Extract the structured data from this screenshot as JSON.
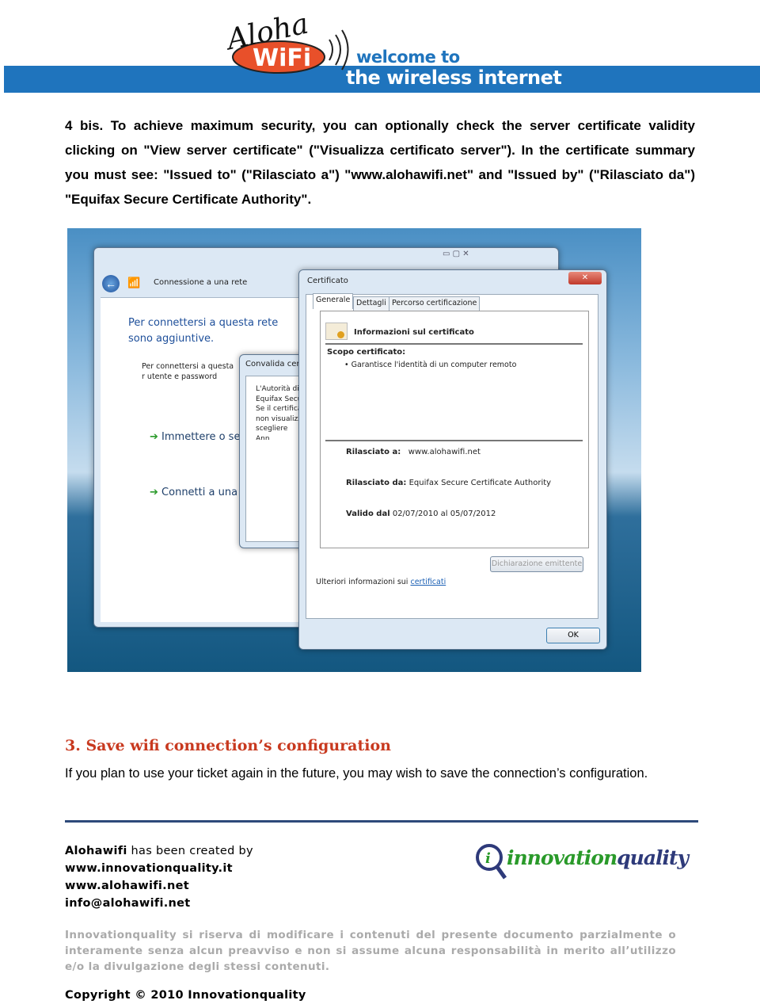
{
  "header": {
    "logo_text": "Aloha WiFi",
    "welcome": "welcome to",
    "tagline": "the wireless internet",
    "brand_blue": "#1f74bd",
    "brand_orange": "#e8502a"
  },
  "intro": "4 bis. To achieve maximum security, you can optionally check the server certificate validity clicking on \"View server certificate\" (\"Visualizza certificato server\"). In the certificate summary you must see: \"Issued to\" (\"Rilasciato a\") \"www.alohawifi.net\" and \"Issued by\" (\"Rilasciato da\") \"Equifax Secure Certificate Authority\".",
  "screenshot": {
    "network_window": {
      "title": "Connessione a una rete",
      "heading": "Per connettersi a questa rete sono aggiuntive.",
      "desc": "Per connettersi a questa r utente e password",
      "option1": "Immettere o se",
      "option2": "Connetti a una"
    },
    "validate_dialog": {
      "title": "Convalida cer",
      "body": "L'Autorità di Equifax Secu Se il certifica non visualizz scegliere Ann"
    },
    "cert_dialog": {
      "title": "Certificato",
      "tabs": [
        "Generale",
        "Dettagli",
        "Percorso certificazione"
      ],
      "info_title": "Informazioni sul certificato",
      "scope_label": "Scopo certificato:",
      "scope_item": "• Garantisce l'identità di un computer remoto",
      "issued_to_label": "Rilasciato a:",
      "issued_to": "www.alohawifi.net",
      "issued_by_label": "Rilasciato da:",
      "issued_by": "Equifax Secure Certificate Authority",
      "valid_label": "Valido dal",
      "valid_from": "02/07/2010",
      "valid_to_label": "al",
      "valid_to": "05/07/2012",
      "issuer_stmt_button": "Dichiarazione emittente",
      "more_info": "Ulteriori informazioni sui",
      "more_info_link": "certificati",
      "ok": "OK"
    }
  },
  "section3": {
    "title": "3. Save wifi connection’s configuration",
    "body": "If you plan to use your ticket again in the future, you may wish to save the connection’s configuration."
  },
  "footer": {
    "created_brand": "Alohawifi",
    "created_rest": " has been created by",
    "links": [
      "www.innovationquality.it",
      "www.alohawifi.net",
      "info@alohawifi.net"
    ],
    "logo_i": "innovation",
    "logo_q": "quality",
    "disclaimer": "Innovationquality si riserva di modificare i contenuti del presente documento parzialmente o interamente senza alcun preavviso e non si assume alcuna responsabilità in merito all’utilizzo e/o la divulgazione degli stessi contenuti.",
    "copyright": "Copyright © 2010 Innovationquality"
  }
}
